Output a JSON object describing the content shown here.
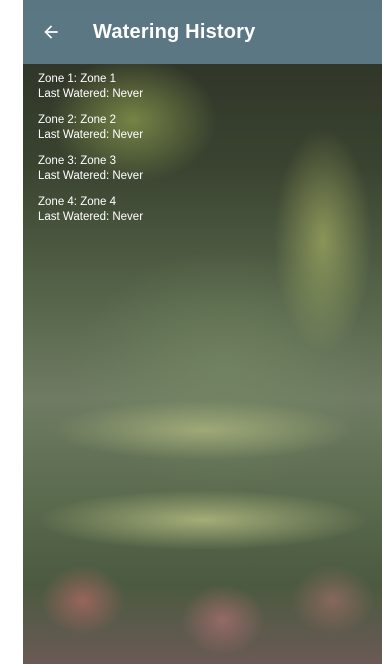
{
  "appbar": {
    "title": "Watering History",
    "back_icon": "arrow-left-icon"
  },
  "zones": [
    {
      "title": "Zone 1: Zone 1",
      "last_watered": "Last Watered: Never"
    },
    {
      "title": "Zone 2: Zone 2",
      "last_watered": "Last Watered: Never"
    },
    {
      "title": "Zone 3: Zone 3",
      "last_watered": "Last Watered: Never"
    },
    {
      "title": "Zone 4: Zone 4",
      "last_watered": "Last Watered: Never"
    }
  ],
  "colors": {
    "appbar": "#607D8B",
    "text": "#FFFFFF"
  }
}
